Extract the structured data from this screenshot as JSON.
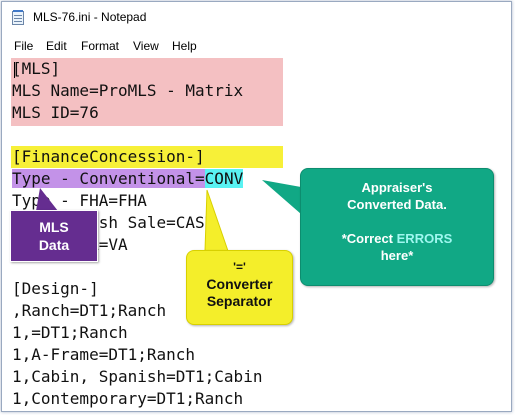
{
  "window": {
    "title": "MLS-76.ini - Notepad",
    "icon": "notepad-icon"
  },
  "menu": [
    "File",
    "Edit",
    "Format",
    "View",
    "Help"
  ],
  "editor": {
    "lines": [
      "[MLS]",
      "MLS Name=ProMLS - Matrix",
      "MLS ID=76",
      "",
      "[FinanceConcession-]",
      "Type - Conventional=CONV",
      "Type - FHA=FHA",
      "Type - Cash Sale=CASH",
      "Type - VA=VA",
      "",
      "[Design-]",
      ",Ranch=DT1;Ranch",
      "1,=DT1;Ranch",
      "1,A-Frame=DT1;Ranch",
      "1,Cabin, Spanish=DT1;Cabin",
      "1,Contemporary=DT1;Ranch"
    ],
    "highlight_key": "Type - Conventional",
    "highlight_sep": "=",
    "highlight_value": "CONV"
  },
  "callouts": {
    "mls_data": {
      "line1": "MLS",
      "line2": "Data"
    },
    "separator": {
      "quote": "'='",
      "line1": "Converter",
      "line2": "Separator"
    },
    "appraiser": {
      "line1": "Appraiser's",
      "line2": "Converted Data.",
      "line3_prefix": "*Correct ",
      "line3_emph": "ERRORS",
      "line4": "here*"
    }
  },
  "colors": {
    "pink_highlight": "#f4c0c2",
    "yellow_highlight": "#f7f038",
    "purple": "#c392e8",
    "cyan": "#59f2f2",
    "mls_callout": "#652d90",
    "separator_callout": "#f4ee2a",
    "appraiser_callout": "#11a885"
  }
}
